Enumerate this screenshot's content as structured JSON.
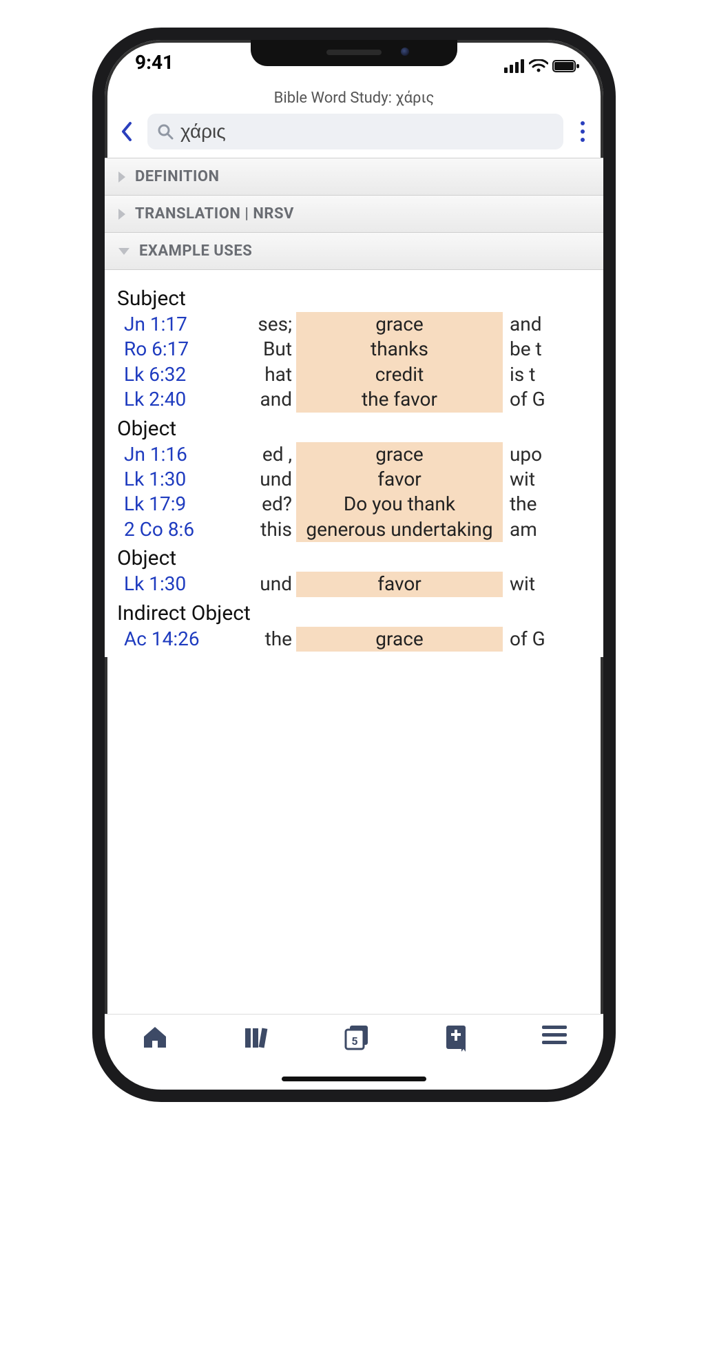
{
  "status": {
    "time": "9:41"
  },
  "header": {
    "title": "Bible Word Study: χάρις"
  },
  "search": {
    "value": "χάρις"
  },
  "sections": {
    "definition_label": "DEFINITION",
    "translation_label": "TRANSLATION | NRSV",
    "example_uses_label": "EXAMPLE USES"
  },
  "example_uses": {
    "groups": [
      {
        "title": "Subject",
        "rows": [
          {
            "ref": "Jn 1:17",
            "pre": "ses;",
            "hl": "grace",
            "post": "and"
          },
          {
            "ref": "Ro 6:17",
            "pre": "But",
            "hl": "thanks",
            "post": "be t"
          },
          {
            "ref": "Lk 6:32",
            "pre": "hat",
            "hl": "credit",
            "post": "is t"
          },
          {
            "ref": "Lk 2:40",
            "pre": "and",
            "hl": "the favor",
            "post": "of G"
          }
        ]
      },
      {
        "title": "Object",
        "rows": [
          {
            "ref": "Jn 1:16",
            "pre": "ed ,",
            "hl": "grace",
            "post": "upo"
          },
          {
            "ref": "Lk 1:30",
            "pre": "und",
            "hl": "favor",
            "post": "wit"
          },
          {
            "ref": "Lk 17:9",
            "pre": "ed?",
            "hl": "Do you thank",
            "post": "the"
          },
          {
            "ref": "2 Co 8:6",
            "pre": "this",
            "hl": "generous undertaking",
            "post": "am"
          }
        ]
      },
      {
        "title": "Object",
        "rows": [
          {
            "ref": "Lk 1:30",
            "pre": "und",
            "hl": "favor",
            "post": "wit"
          }
        ]
      },
      {
        "title": "Indirect Object",
        "rows": [
          {
            "ref": "Ac 14:26",
            "pre": "the",
            "hl": "grace",
            "post": "of G"
          }
        ]
      }
    ]
  },
  "tabbar": {
    "items": [
      "home",
      "library",
      "tabs",
      "bible",
      "menu"
    ],
    "tab_count": "5"
  }
}
